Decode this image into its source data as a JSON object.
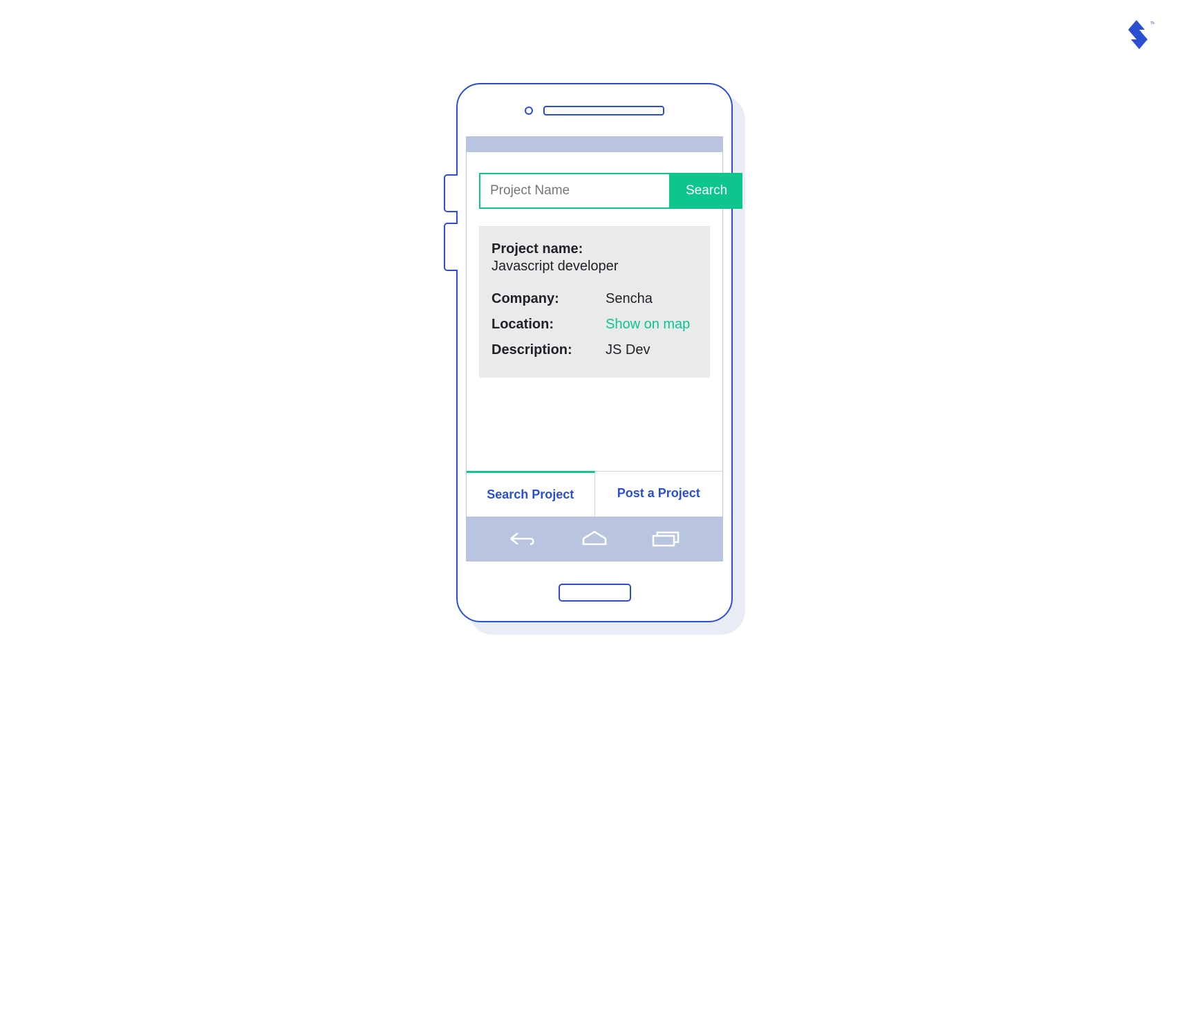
{
  "logo": {
    "tm": "TM"
  },
  "search": {
    "placeholder": "Project Name",
    "button_label": "Search"
  },
  "project": {
    "name_label": "Project name:",
    "name_value": "Javascript developer",
    "company_label": "Company:",
    "company_value": "Sencha",
    "location_label": "Location:",
    "location_value": "Show on map",
    "description_label": "Description:",
    "description_value": "JS Dev"
  },
  "tabs": {
    "search_project": "Search Project",
    "post_project": "Post a Project"
  }
}
